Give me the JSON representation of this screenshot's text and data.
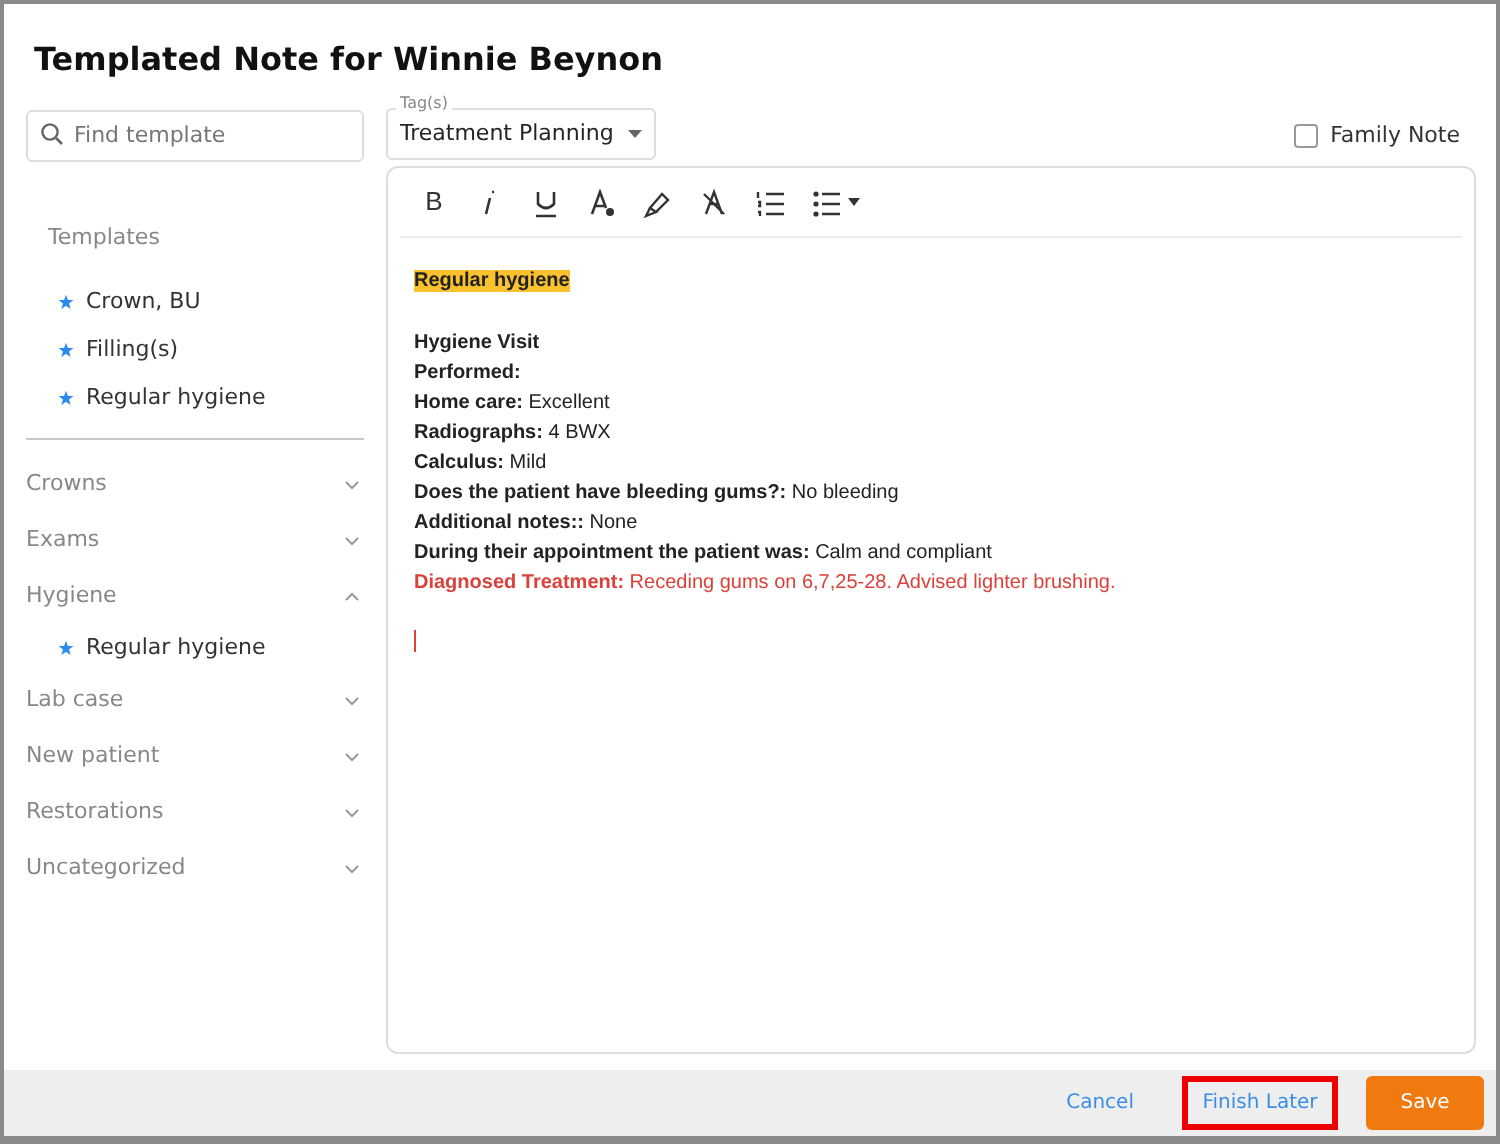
{
  "dialog": {
    "title": "Templated Note for Winnie Beynon"
  },
  "search": {
    "placeholder": "Find template"
  },
  "favorites": {
    "heading": "Templates",
    "items": [
      "Crown, BU",
      "Filling(s)",
      "Regular hygiene"
    ]
  },
  "categories": [
    {
      "name": "Crowns",
      "expanded": false
    },
    {
      "name": "Exams",
      "expanded": false
    },
    {
      "name": "Hygiene",
      "expanded": true,
      "items": [
        "Regular hygiene"
      ]
    },
    {
      "name": "Lab case",
      "expanded": false
    },
    {
      "name": "New patient",
      "expanded": false
    },
    {
      "name": "Restorations",
      "expanded": false
    },
    {
      "name": "Uncategorized",
      "expanded": false
    }
  ],
  "toolbar": {
    "bold_label": "B"
  },
  "tags": {
    "label": "Tag(s)",
    "value": "Treatment Planning"
  },
  "family_note": {
    "label": "Family Note",
    "checked": false
  },
  "note_lines": [
    {
      "kind": "heading",
      "text": "Regular hygiene"
    },
    {
      "kind": "field",
      "text": "**Hygiene Visit**"
    },
    {
      "kind": "field",
      "text": "**Performed:**"
    },
    {
      "kind": "field",
      "text": "**Home care:** Excellent"
    },
    {
      "kind": "field",
      "text": "**Radiographs:** 4 BWX"
    },
    {
      "kind": "field",
      "text": "**Calculus:** Mild"
    },
    {
      "kind": "field",
      "text": "**Does the patient have bleeding gums?:** No bleeding"
    },
    {
      "kind": "field",
      "text": "**Additional notes::** None"
    },
    {
      "kind": "field",
      "text": "**During their appointment the patient was:** Calm and compliant"
    },
    {
      "kind": "alert",
      "text": "**Diagnosed Treatment:** Receding gums on 6,7,25-28. Advised lighter brushing."
    }
  ],
  "buttons": [
    {
      "kind": "link",
      "label": "Cancel",
      "highlighted": false
    },
    {
      "kind": "link",
      "label": "Finish Later",
      "highlighted": true
    },
    {
      "kind": "primary",
      "label": "Save",
      "highlighted": false
    }
  ]
}
